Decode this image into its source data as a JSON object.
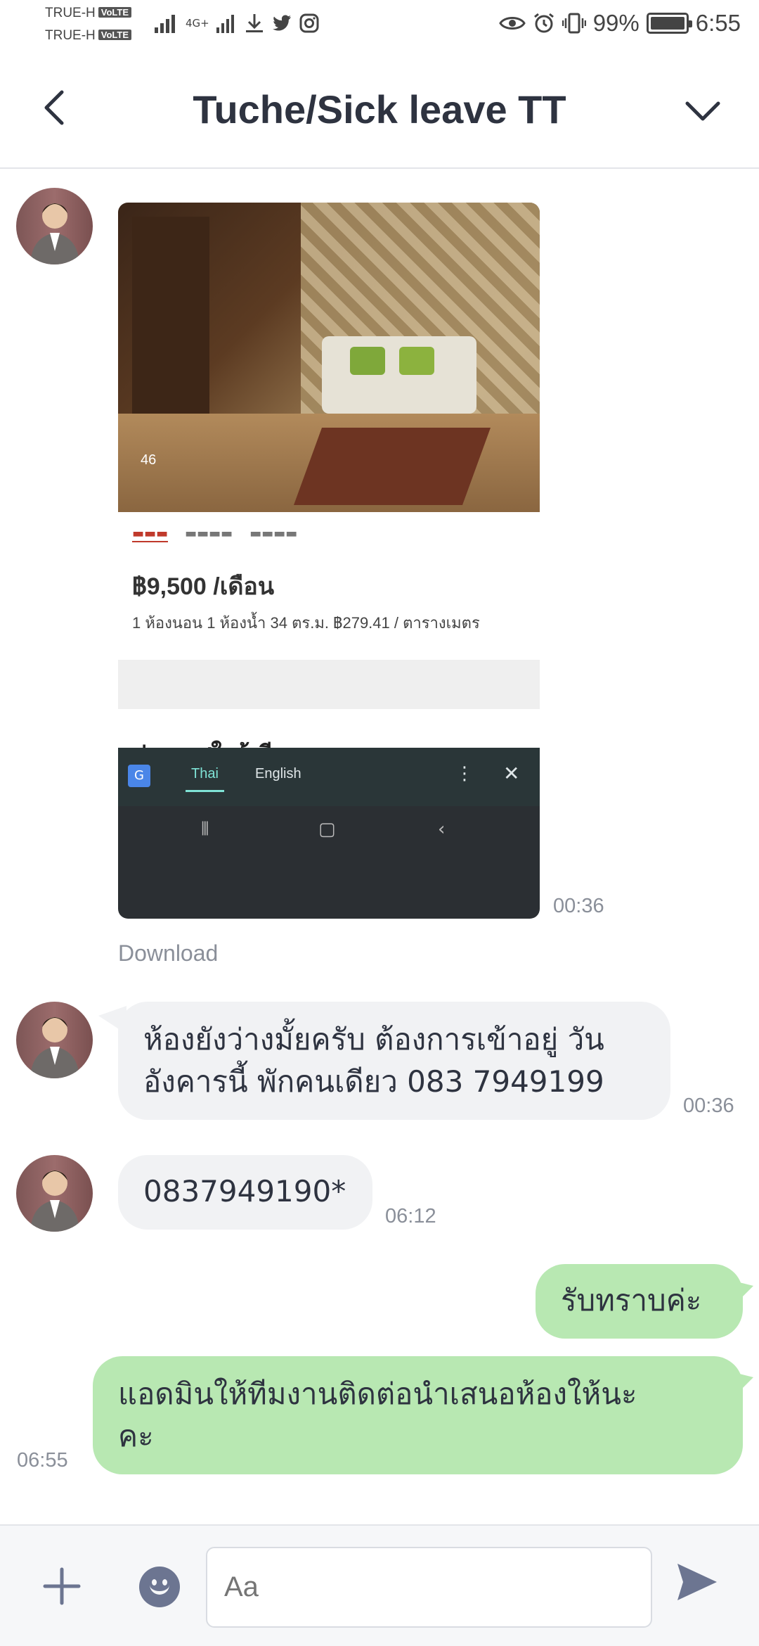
{
  "status_bar": {
    "carrier1": "TRUE-H",
    "carrier2": "TRUE-H",
    "volte": "VoLTE",
    "network": "4G+",
    "battery_percent": "99%",
    "battery_level": 0.99,
    "clock": "6:55"
  },
  "header": {
    "title": "Tuche/Sick leave TT"
  },
  "messages": [
    {
      "type": "image",
      "direction": "incoming",
      "time": "00:36",
      "download_label": "Download",
      "image_content": {
        "photo_count": "46",
        "price": "฿9,500 /เดือน",
        "specs": "1 ห้องนอน  1 ห้องน้ำ  34 ตร.ม.  ฿279.41 / ตารางเมตร",
        "heading": "ประกาศใกล้เคียง",
        "translate_lang1": "Thai",
        "translate_lang2": "English"
      }
    },
    {
      "type": "text",
      "direction": "incoming",
      "line1": "ห้องยังว่างมั้ยครับ ต้องการเข้าอยู่ วัน",
      "line2": "อังคารนี้ พักคนเดียว 083 7949199",
      "time": "00:36"
    },
    {
      "type": "text",
      "direction": "incoming",
      "text": "0837949190*",
      "time": "06:12"
    },
    {
      "type": "text",
      "direction": "outgoing",
      "text": "รับทราบค่ะ"
    },
    {
      "type": "text",
      "direction": "outgoing",
      "line1": "แอดมินให้ทีมงานติดต่อนำเสนอห้องให้นะ",
      "line2": "คะ",
      "time": "06:55"
    }
  ],
  "composer": {
    "placeholder": "Aa"
  },
  "colors": {
    "incoming_bubble": "#f1f2f4",
    "outgoing_bubble": "#b8e8b2",
    "icon": "#6c7591"
  },
  "icons": {
    "back": "chevron-left-icon",
    "dropdown": "chevron-down-icon",
    "plus": "plus-icon",
    "emoji": "smiley-icon",
    "send": "send-icon"
  }
}
